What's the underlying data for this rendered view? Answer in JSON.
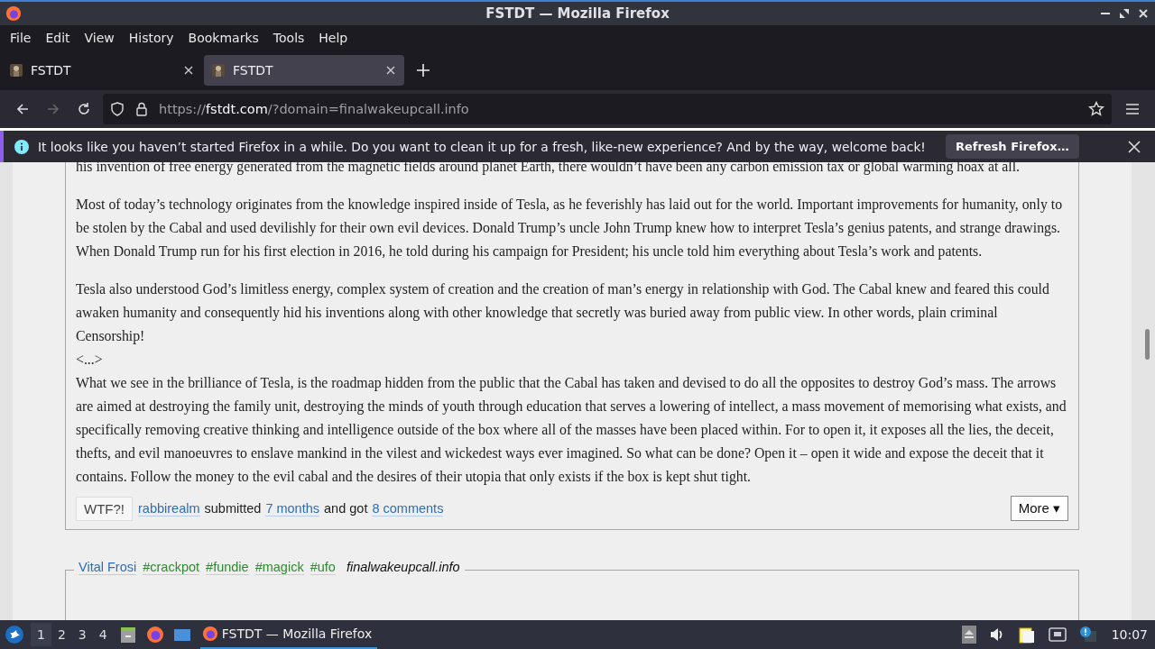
{
  "window": {
    "title": "FSTDT — Mozilla Firefox"
  },
  "menu": [
    "File",
    "Edit",
    "View",
    "History",
    "Bookmarks",
    "Tools",
    "Help"
  ],
  "tabs": [
    {
      "label": "FSTDT",
      "selected": false
    },
    {
      "label": "FSTDT",
      "selected": true
    }
  ],
  "url": {
    "scheme": "https://",
    "host": "fstdt.com",
    "path": "/?domain=finalwakeupcall.info"
  },
  "notification": {
    "message": "It looks like you haven’t started Firefox in a while. Do you want to clean it up for a fresh, like-new experience? And by the way, welcome back!",
    "button": "Refresh Firefox…"
  },
  "post": {
    "paragraphs": [
      {
        "lines": [
          "his invention of free energy generated from the magnetic fields around planet Earth, there wouldn’t have been any carbon emission tax or global warming hoax at all."
        ]
      },
      {
        "lines": [
          "Most of today’s technology originates from the knowledge inspired inside of Tesla, as he feverishly has laid out for the world. Important improvements for humanity, only to be stolen by the Cabal and used devilishly for their own evil devices. Donald Trump’s uncle John Trump knew how to interpret Tesla’s genius patents, and strange drawings. When Donald Trump run for his first election in 2016, he told during his campaign for President; his uncle told him everything about Tesla’s work and patents."
        ]
      },
      {
        "lines": [
          "Tesla also understood God’s limitless energy, complex system of creation and the creation of man’s energy in relationship with God. The Cabal knew and feared this could awaken humanity and consequently hid his inventions along with other knowledge that secretly was buried away from public view. In other words, plain criminal Censorship!",
          "<...>",
          "What we see in the brilliance of Tesla, is the roadmap hidden from the public that the Cabal has taken and devised to do all the opposites to destroy God’s mass. The arrows are aimed at destroying the family unit, destroying the minds of youth through education that serves a lowering of intellect, a mass movement of memorising what exists, and specifically removing creative thinking and intelligence outside of the box where all of the masses have been placed within. For to open it, it exposes all the lies, the deceit, thefts, and evil manoeuvres to enslave mankind in the vilest and wickedest ways ever imagined. So what can be done? Open it – open it wide and expose the deceit that it contains. Follow the money to the evil cabal and the desires of their utopia that only exists if the box is kept shut tight."
        ]
      }
    ],
    "vote_button": "WTF?!",
    "author": "rabbirealm",
    "submitted_text": "submitted",
    "age": "7 months",
    "and_got_text": "and got",
    "comments": "8 comments",
    "more_button": "More ▾"
  },
  "next_post": {
    "author": "Vital Frosi",
    "tags": [
      "#crackpot",
      "#fundie",
      "#magick",
      "#ufo"
    ],
    "domain": "finalwakeupcall.info"
  },
  "taskbar": {
    "workspaces": [
      {
        "label": "1",
        "selected": true
      },
      {
        "label": "2",
        "selected": false
      },
      {
        "label": "3",
        "selected": false
      },
      {
        "label": "4",
        "selected": false
      }
    ],
    "window_button": "FSTDT — Mozilla Firefox",
    "clock": "10:07"
  }
}
